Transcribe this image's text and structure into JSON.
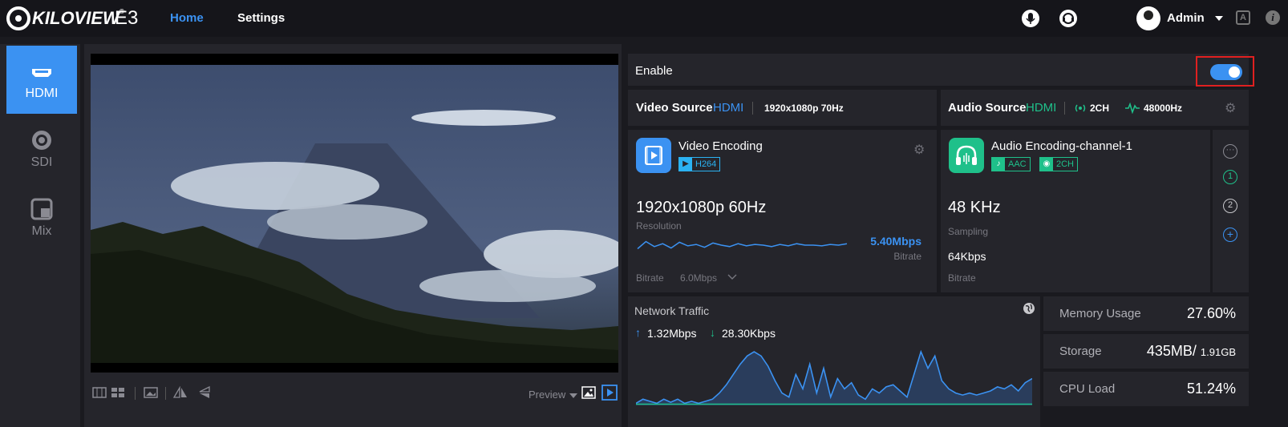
{
  "header": {
    "logo_text": "KILOVIEW",
    "logo_reg": "®",
    "model": "E3",
    "nav": [
      {
        "label": "Home",
        "active": true
      },
      {
        "label": "Settings",
        "active": false
      }
    ],
    "user": "Admin",
    "lang_icon_letter": "A",
    "info_icon_letter": "i"
  },
  "sidebar": {
    "items": [
      {
        "label": "HDMI",
        "icon": "hdmi-icon",
        "active": true
      },
      {
        "label": "SDI",
        "icon": "sdi-icon",
        "active": false
      },
      {
        "label": "Mix",
        "icon": "mix-icon",
        "active": false
      }
    ]
  },
  "preview": {
    "label": "Preview"
  },
  "enable": {
    "label": "Enable",
    "on": true
  },
  "video_source": {
    "title": "Video Source",
    "source": "HDMI",
    "format": "1920x1080p 70Hz"
  },
  "audio_source": {
    "title": "Audio Source",
    "source": "HDMI",
    "channels": "2CH",
    "rate": "48000Hz"
  },
  "video_encoding": {
    "title": "Video Encoding",
    "codec": "H264",
    "resolution": "1920x1080p 60Hz",
    "resolution_label": "Resolution",
    "bitrate_value": "5.40Mbps",
    "bitrate_label_right": "Bitrate",
    "bitrate_label": "Bitrate",
    "bitrate_setting": "6.0Mbps",
    "bitrate_history": [
      5.35,
      5.45,
      5.38,
      5.42,
      5.36,
      5.44,
      5.39,
      5.41,
      5.37,
      5.43,
      5.4,
      5.38,
      5.42,
      5.39,
      5.41,
      5.4,
      5.38,
      5.41,
      5.39,
      5.42,
      5.4,
      5.4,
      5.39,
      5.41,
      5.4,
      5.42
    ]
  },
  "audio_encoding": {
    "title": "Audio Encoding-channel-1",
    "codec": "AAC",
    "channels": "2CH",
    "sampling": "48 KHz",
    "sampling_label": "Sampling",
    "bitrate": "64Kbps",
    "bitrate_label": "Bitrate"
  },
  "channels": {
    "items": [
      "1",
      "2"
    ]
  },
  "network": {
    "title": "Network Traffic",
    "up": "1.32Mbps",
    "down": "28.30Kbps",
    "up_series": [
      0.1,
      0.3,
      0.2,
      0.1,
      0.3,
      0.15,
      0.3,
      0.1,
      0.2,
      0.1,
      0.2,
      0.3,
      0.6,
      1.0,
      1.5,
      2.0,
      2.4,
      2.6,
      2.4,
      1.9,
      1.2,
      0.6,
      0.4,
      1.5,
      0.8,
      2.0,
      0.6,
      1.8,
      0.4,
      1.3,
      0.8,
      1.1,
      0.5,
      0.3,
      0.8,
      0.6,
      0.9,
      1.0,
      0.7,
      0.4,
      1.5,
      2.6,
      1.8,
      2.4,
      1.2,
      0.8,
      0.6,
      0.5,
      0.6,
      0.5,
      0.6,
      0.7,
      0.9,
      0.8,
      1.0,
      0.7,
      1.1,
      1.3
    ],
    "down_series": [
      0.02,
      0.02,
      0.02,
      0.02,
      0.02,
      0.02,
      0.02,
      0.02,
      0.02,
      0.02
    ]
  },
  "stats": [
    {
      "label": "Memory Usage",
      "value": "27.60%"
    },
    {
      "label": "Storage",
      "value": "435MB/",
      "value_small": "1.91GB"
    },
    {
      "label": "CPU Load",
      "value": "51.24%"
    }
  ],
  "colors": {
    "accent": "#3b92f2",
    "green": "#1fc08a",
    "panel": "#25252b",
    "bg": "#1a1a1f"
  }
}
